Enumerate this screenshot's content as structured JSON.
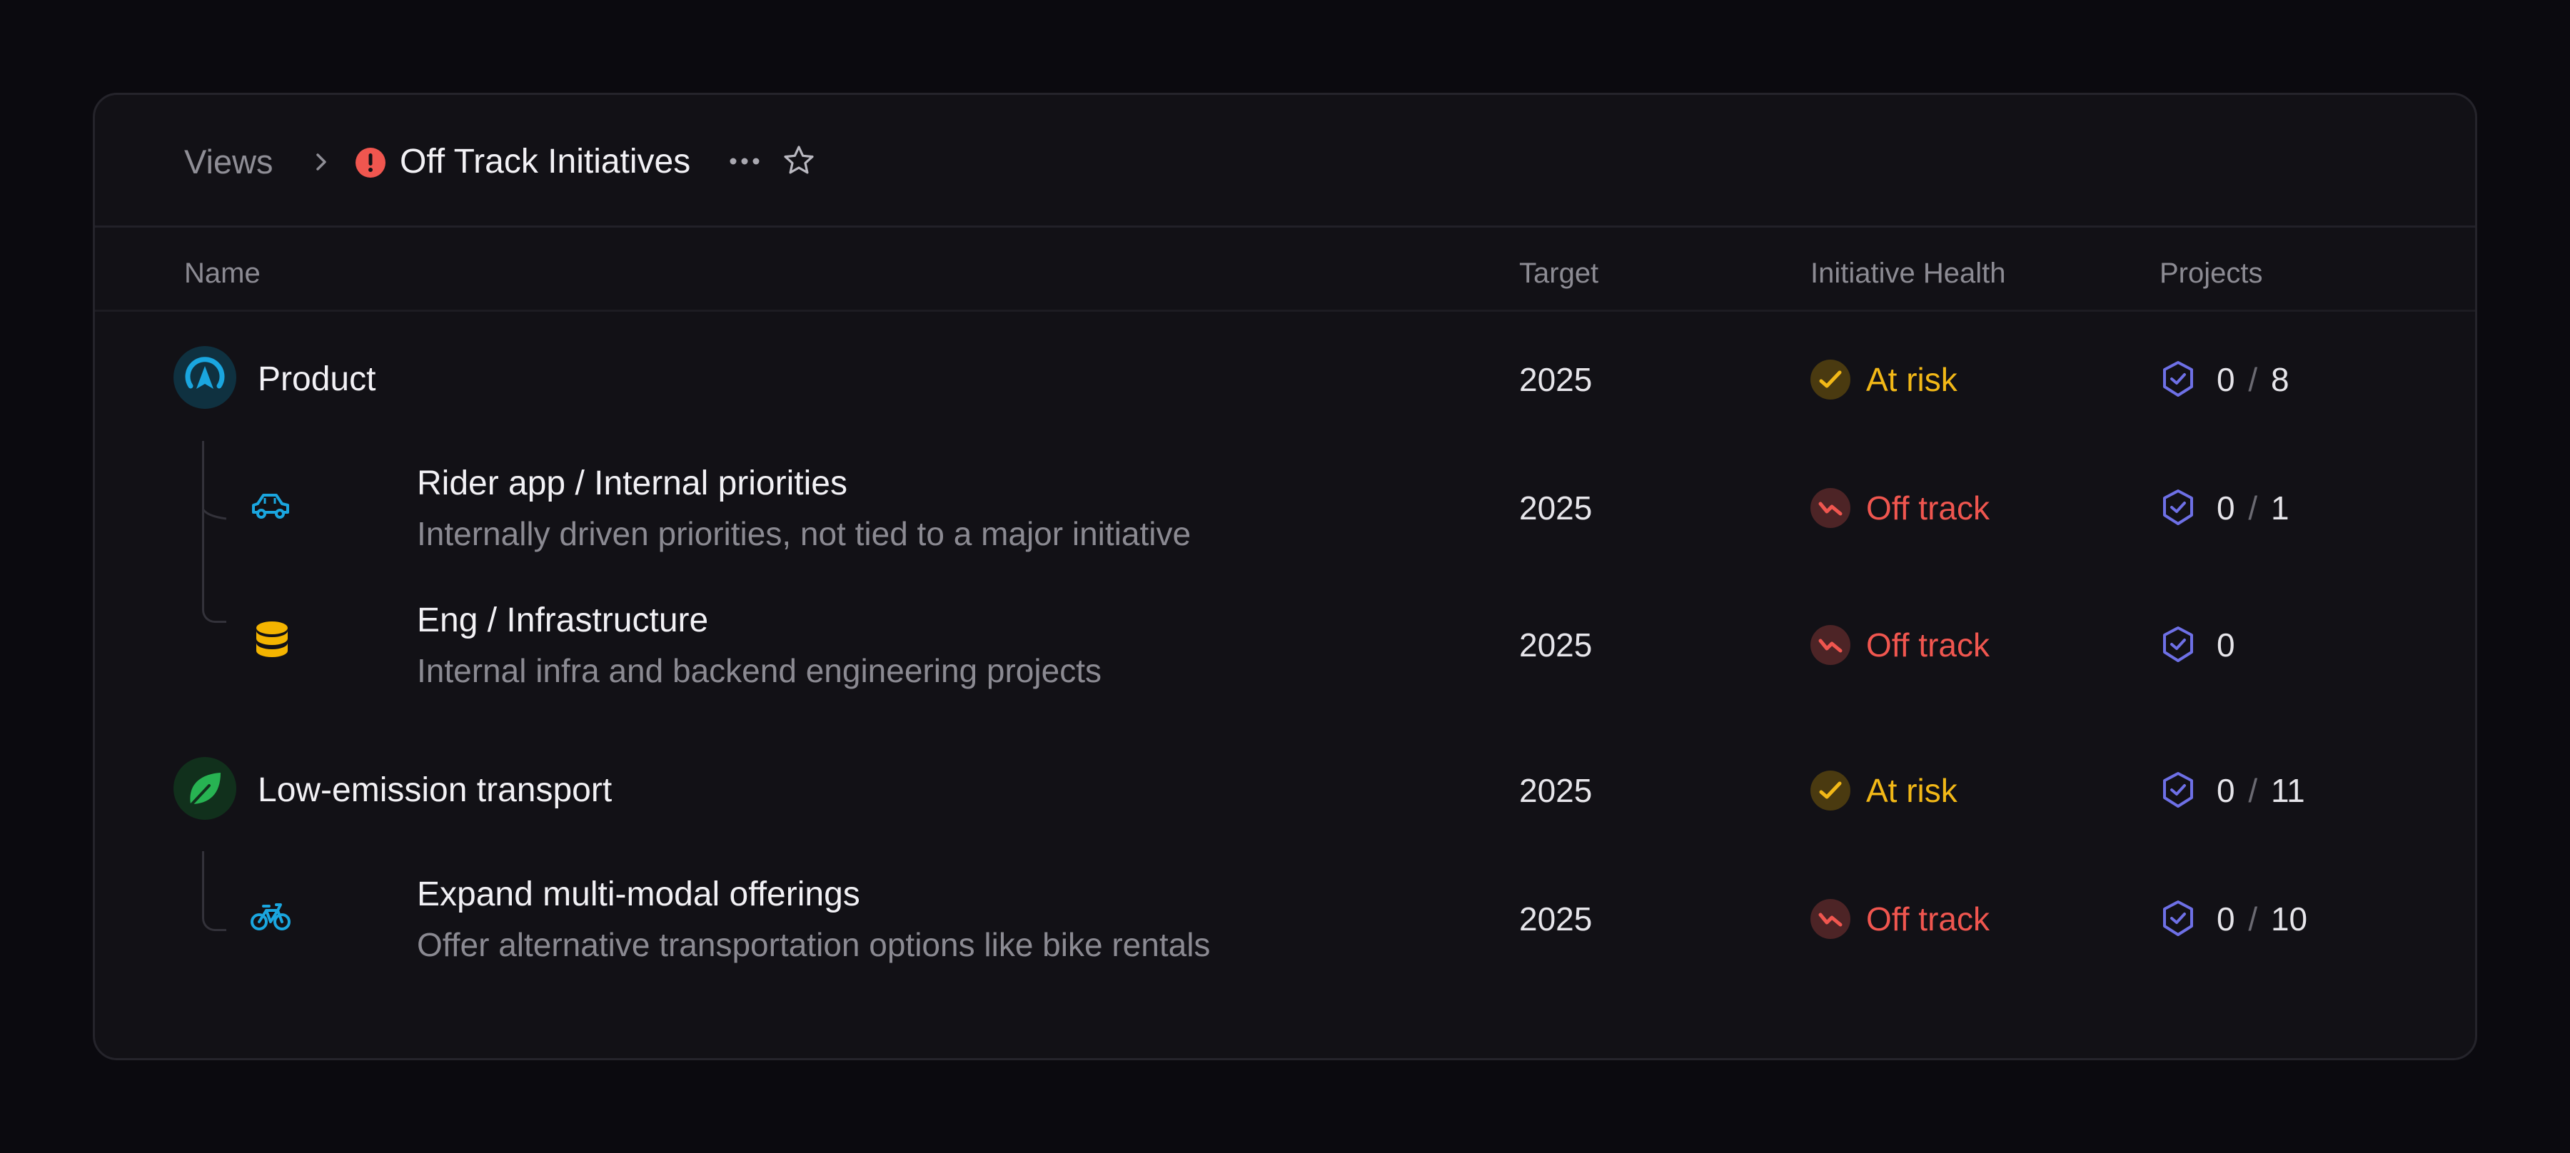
{
  "breadcrumb": {
    "views_label": "Views",
    "title": "Off Track Initiatives"
  },
  "columns": {
    "name": "Name",
    "target": "Target",
    "health": "Initiative Health",
    "projects": "Projects"
  },
  "rows": [
    {
      "title": "Product",
      "description": "",
      "target": "2025",
      "health": "At risk",
      "projects_done": "0",
      "projects_sep": "/",
      "projects_total": "8",
      "icon": "compass-icon"
    },
    {
      "title": "Rider app / Internal priorities",
      "description": "Internally driven priorities, not tied to a major initiative",
      "target": "2025",
      "health": "Off track",
      "projects_done": "0",
      "projects_sep": "/",
      "projects_total": "1",
      "icon": "car-icon"
    },
    {
      "title": "Eng / Infrastructure",
      "description": "Internal infra and backend engineering projects",
      "target": "2025",
      "health": "Off track",
      "projects_done": "0",
      "projects_sep": "",
      "projects_total": "",
      "icon": "database-icon"
    },
    {
      "title": "Low-emission transport",
      "description": "",
      "target": "2025",
      "health": "At risk",
      "projects_done": "0",
      "projects_sep": "/",
      "projects_total": "11",
      "icon": "leaf-icon"
    },
    {
      "title": "Expand multi-modal offerings",
      "description": "Offer alternative transportation options like bike rentals",
      "target": "2025",
      "health": "Off track",
      "projects_done": "0",
      "projects_sep": "/",
      "projects_total": "10",
      "icon": "bicycle-icon"
    }
  ],
  "colors": {
    "at_risk": "#f2b817",
    "off_track": "#f0564f",
    "project_icon": "#6e70e6",
    "product_icon": "#1aa6df",
    "leaf_icon": "#27b352",
    "car_icon": "#1aa6df",
    "database_icon": "#f4b400"
  }
}
